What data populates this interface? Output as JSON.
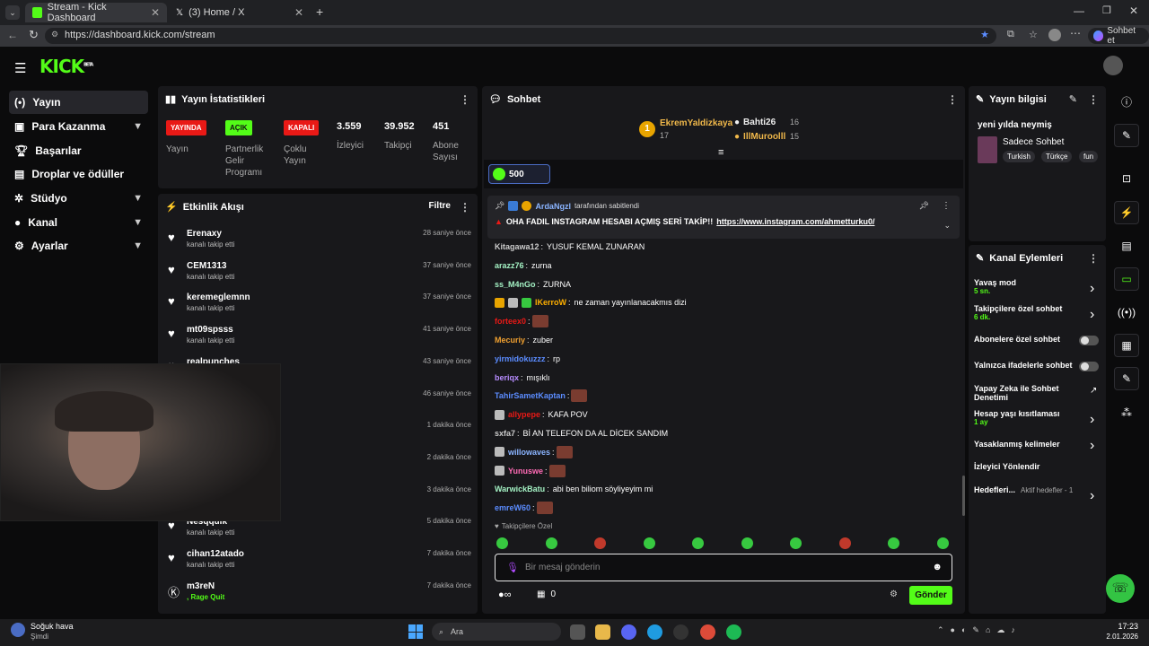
{
  "browser": {
    "tabs": [
      {
        "title": "Stream - Kick Dashboard"
      },
      {
        "title": "(3) Home / X"
      }
    ],
    "url": "https://dashboard.kick.com/stream",
    "profile_button": "Sohbet et"
  },
  "logo": {
    "text": "KICK",
    "beta": "BETA"
  },
  "sidebar": {
    "items": [
      {
        "label": "Yayın"
      },
      {
        "label": "Para Kazanma"
      },
      {
        "label": "Başarılar"
      },
      {
        "label": "Droplar ve ödüller"
      },
      {
        "label": "Stüdyo"
      },
      {
        "label": "Kanal"
      },
      {
        "label": "Ayarlar"
      }
    ]
  },
  "stats": {
    "title": "Yayın İstatistikleri",
    "badges": [
      {
        "text": "YAYINDA",
        "label": "Yayın",
        "color": "#e91916"
      },
      {
        "text": "AÇIK",
        "label": "Partnerlik Gelir Programı",
        "color": "#53fc18"
      },
      {
        "text": "KAPALI",
        "label": "Çoklu Yayın",
        "color": "#e91916"
      }
    ],
    "numbers": [
      {
        "value": "3.559",
        "label": "İzleyici"
      },
      {
        "value": "39.952",
        "label": "Takipçi"
      },
      {
        "value": "451",
        "label": "Abone Sayısı"
      }
    ]
  },
  "activity": {
    "title": "Etkinlik Akışı",
    "filter": "Filtre",
    "items": [
      {
        "name": "Erenaxy",
        "sub": "kanalı takip etti",
        "time": "28 saniye önce"
      },
      {
        "name": "CEM1313",
        "sub": "kanalı takip etti",
        "time": "37 saniye önce"
      },
      {
        "name": "keremeglemnn",
        "sub": "kanalı takip etti",
        "time": "37 saniye önce"
      },
      {
        "name": "mt09spsss",
        "sub": "kanalı takip etti",
        "time": "41 saniye önce"
      },
      {
        "name": "realpunches",
        "sub": "",
        "time": "43 saniye önce"
      },
      {
        "name": "",
        "sub": "",
        "time": "46 saniye önce"
      },
      {
        "name": "",
        "sub": "",
        "time": "1 dakika önce"
      },
      {
        "name": "",
        "sub": "",
        "time": "2 dakika önce"
      },
      {
        "name": "",
        "sub": "",
        "time": "3 dakika önce"
      },
      {
        "name": "Nesqquik",
        "sub": "kanalı takip etti",
        "time": "5 dakika önce"
      },
      {
        "name": "cihan12atado",
        "sub": "kanalı takip etti",
        "time": "7 dakika önce"
      },
      {
        "name": "m3reN",
        "sub": ", Rage Quit",
        "time": "7 dakika önce"
      }
    ]
  },
  "chat": {
    "title": "Sohbet",
    "leaders": [
      {
        "rank": "1",
        "name": "EkremYaldizkaya",
        "count": "17"
      },
      {
        "name": "Bahti26",
        "count": "16"
      },
      {
        "name": "IllMuroolll",
        "count": "15"
      }
    ],
    "gift_count": "500",
    "pinned": {
      "user": "ArdaNgzl",
      "note": "tarafından sabitlendi",
      "text": "OHA FADIL INSTAGRAM HESABI AÇMIŞ SERİ TAKİP!!",
      "link": "https://www.instagram.com/ahmetturku0/"
    },
    "messages": [
      {
        "user": "Kitagawa12",
        "color": "#cccccc",
        "text": "YUSUF KEMAL ZUNARAN"
      },
      {
        "user": "arazz76",
        "color": "#a4f2c4",
        "text": "zurna"
      },
      {
        "user": "ss_M4nGo",
        "color": "#a4f2c4",
        "text": "ZURNA"
      },
      {
        "user": "lKerroW",
        "color": "#ffb000",
        "text": "ne zaman yayınlanacakmıs dizi"
      },
      {
        "user": "forteex0",
        "color": "#e91916",
        "text": ""
      },
      {
        "user": "Mecuriy",
        "color": "#f0a030",
        "text": "zuber"
      },
      {
        "user": "yirmidokuzzz",
        "color": "#5b8cff",
        "text": "rp"
      },
      {
        "user": "beriqx",
        "color": "#b78cff",
        "text": "mışıklı"
      },
      {
        "user": "TahirSametKaptan",
        "color": "#5b8cff",
        "text": ""
      },
      {
        "user": "allypepe",
        "color": "#e91916",
        "text": "KAFA POV"
      },
      {
        "user": "sxfa7",
        "color": "#cccccc",
        "text": "Bİ AN TELEFON DA AL DİCEK SANDIM"
      },
      {
        "user": "willowaves",
        "color": "#8ab4ff",
        "text": ""
      },
      {
        "user": "Yunuswe",
        "color": "#ff6bb5",
        "text": ""
      },
      {
        "user": "WarwickBatu",
        "color": "#a4f2c4",
        "text": "abi ben biliom söyliyeyim mi"
      },
      {
        "user": "emreW60",
        "color": "#5b8cff",
        "text": ""
      }
    ],
    "followers_only": "Takipçilere Özel",
    "input_placeholder": "Bir mesaj gönderin",
    "send_label": "Gönder",
    "points": "0"
  },
  "stream_info": {
    "title": "Yayın bilgisi",
    "stream_title": "yeni yılda neymiş",
    "category": "Sadece Sohbet",
    "tags": [
      "Turkish",
      "Türkçe",
      "fun"
    ]
  },
  "channel_actions": {
    "title": "Kanal Eylemleri",
    "items": [
      {
        "label": "Yavaş mod",
        "value": "5 sn.",
        "control": "arrow"
      },
      {
        "label": "Takipçilere özel sohbet",
        "value": "6 dk.",
        "control": "arrow"
      },
      {
        "label": "Abonelere özel sohbet",
        "value": "",
        "control": "toggle"
      },
      {
        "label": "Yalnızca ifadelerle sohbet",
        "value": "",
        "control": "toggle"
      },
      {
        "label": "Yapay Zeka ile Sohbet Denetimi",
        "value": "",
        "control": "external"
      },
      {
        "label": "Hesap yaşı kısıtlaması",
        "value": "1 ay",
        "control": "arrow"
      },
      {
        "label": "Yasaklanmış kelimeler",
        "value": "",
        "control": "arrow"
      },
      {
        "label": "İzleyici Yönlendir",
        "value": "",
        "control": "none"
      },
      {
        "label": "Hedefleri...",
        "value": "Aktif hedefler - 1",
        "control": "arrow"
      }
    ]
  },
  "taskbar": {
    "weather": "Soğuk hava",
    "weather_sub": "Şimdi",
    "search": "Ara",
    "time": "17:23",
    "date": "2.01.2026"
  },
  "colors": {
    "kick_green": "#53fc18",
    "red": "#e91916",
    "panel": "#18181b"
  }
}
